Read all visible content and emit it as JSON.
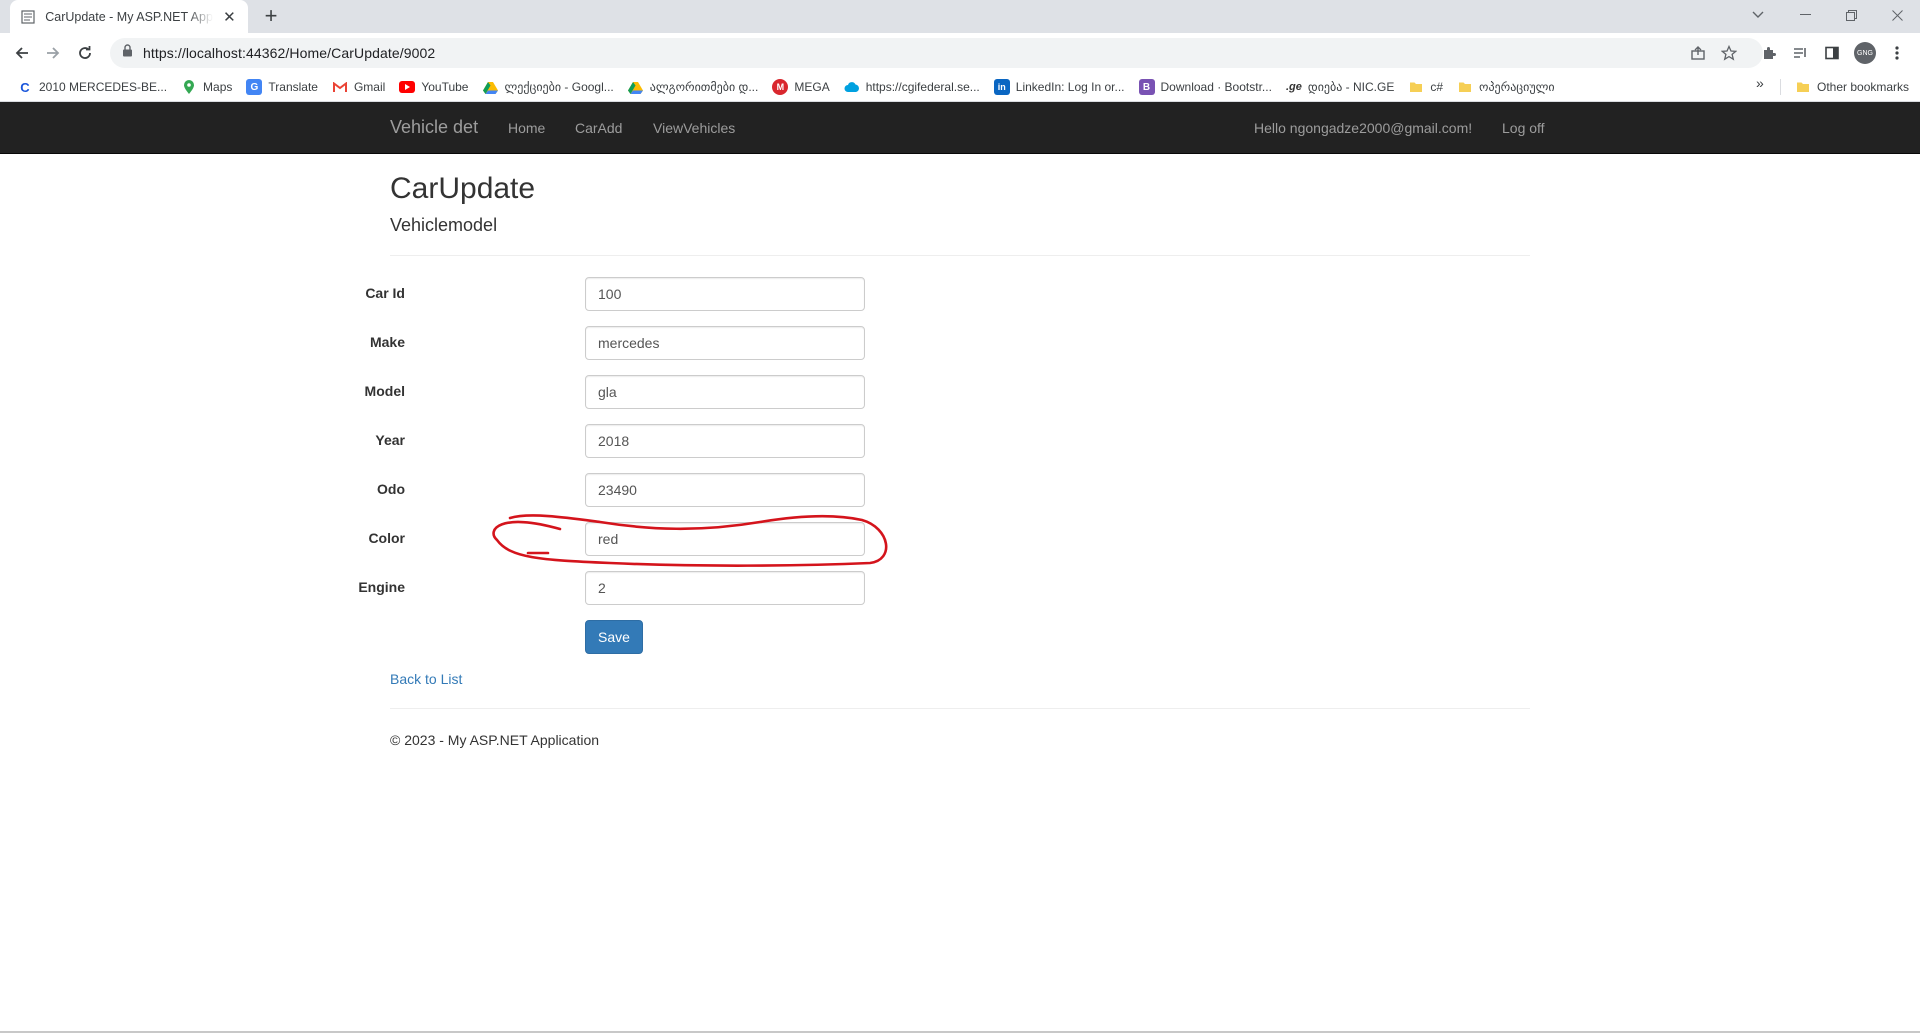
{
  "browser": {
    "tab_title": "CarUpdate - My ASP.NET Application",
    "url": "https://localhost:44362/Home/CarUpdate/9002",
    "profile_initials": "GNG",
    "bookmarks": [
      {
        "label": "2010 MERCEDES-BE...",
        "icon": "c-logo-icon",
        "color": "#1a56db"
      },
      {
        "label": "Maps",
        "icon": "maps-pin-icon",
        "color": "#34a853"
      },
      {
        "label": "Translate",
        "icon": "translate-icon",
        "color": "#4285f4"
      },
      {
        "label": "Gmail",
        "icon": "gmail-icon",
        "color": "#ea4335"
      },
      {
        "label": "YouTube",
        "icon": "youtube-icon",
        "color": "#ff0000"
      },
      {
        "label": "ლექციები - Googl...",
        "icon": "drive-icon",
        "color": "#fbbc04"
      },
      {
        "label": "ალგორითმები დ...",
        "icon": "drive-icon",
        "color": "#fbbc04"
      },
      {
        "label": "MEGA",
        "icon": "mega-icon",
        "color": "#d9272e"
      },
      {
        "label": "https://cgifederal.se...",
        "icon": "cloud-icon",
        "color": "#00a1e0"
      },
      {
        "label": "LinkedIn: Log In or...",
        "icon": "linkedin-icon",
        "color": "#0a66c2"
      },
      {
        "label": "Download · Bootstr...",
        "icon": "bootstrap-icon",
        "color": "#7952b3"
      },
      {
        "label": "დიება - NIC.GE",
        "icon": "ge-icon",
        "color": "#333333"
      },
      {
        "label": "c#",
        "icon": "folder-icon",
        "color": "#f6cf55"
      },
      {
        "label": "ოპერაციული",
        "icon": "folder-icon",
        "color": "#f6cf55"
      }
    ],
    "more_bookmarks": "»",
    "other_bookmarks": "Other bookmarks"
  },
  "navbar": {
    "brand": "Vehicle det",
    "links": [
      "Home",
      "CarAdd",
      "ViewVehicles"
    ],
    "greeting": "Hello ngongadze2000@gmail.com!",
    "logoff": "Log off"
  },
  "page": {
    "title": "CarUpdate",
    "subtitle": "Vehiclemodel"
  },
  "form": {
    "fields": [
      {
        "label": "Car Id",
        "value": "100"
      },
      {
        "label": "Make",
        "value": "mercedes"
      },
      {
        "label": "Model",
        "value": "gla"
      },
      {
        "label": "Year",
        "value": "2018"
      },
      {
        "label": "Odo",
        "value": "23490"
      },
      {
        "label": "Color",
        "value": "red"
      },
      {
        "label": "Engine",
        "value": "2"
      }
    ],
    "save_label": "Save",
    "back_label": "Back to List"
  },
  "footer": {
    "text": "© 2023 - My ASP.NET Application"
  },
  "colors": {
    "navbar_bg": "#222222",
    "navbar_text": "#9d9d9d",
    "primary": "#337ab7",
    "annotation": "#d4141c"
  }
}
